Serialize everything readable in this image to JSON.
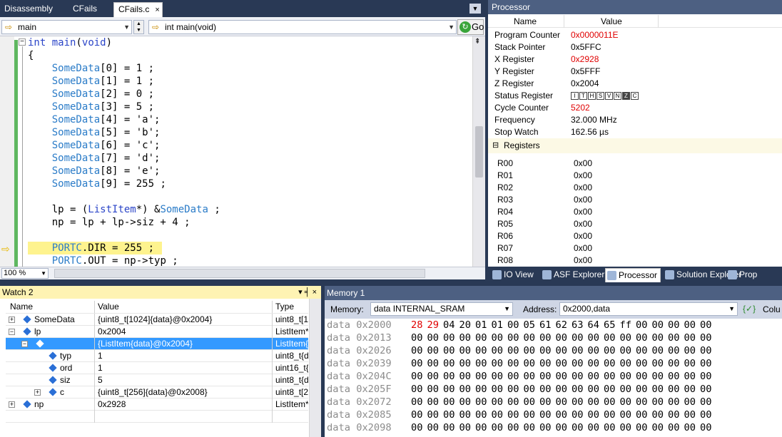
{
  "editor_tabs": [
    {
      "label": "Disassembly"
    },
    {
      "label": "CFails"
    },
    {
      "label": "CFails.c",
      "close": "×"
    }
  ],
  "navbar": {
    "scope": "main",
    "function": "int main(void)",
    "go_label": "Go"
  },
  "code_lines": [
    {
      "t": "int main(void)"
    },
    {
      "t": "{"
    },
    {
      "t": "    SomeData[0] = 1 ;"
    },
    {
      "t": "    SomeData[1] = 1 ;"
    },
    {
      "t": "    SomeData[2] = 0 ;"
    },
    {
      "t": "    SomeData[3] = 5 ;"
    },
    {
      "t": "    SomeData[4] = 'a';"
    },
    {
      "t": "    SomeData[5] = 'b';"
    },
    {
      "t": "    SomeData[6] = 'c';"
    },
    {
      "t": "    SomeData[7] = 'd';"
    },
    {
      "t": "    SomeData[8] = 'e';"
    },
    {
      "t": "    SomeData[9] = 255 ;"
    },
    {
      "t": ""
    },
    {
      "t": "    lp = (ListItem*) &SomeData ;"
    },
    {
      "t": "    np = lp + lp->siz + 4 ;"
    },
    {
      "t": ""
    },
    {
      "t": "    PORTC.DIR = 255 ;"
    },
    {
      "t": "    PORTC.OUT = np->typ ;"
    }
  ],
  "zoom": "100 %",
  "processor": {
    "title": "Processor",
    "col_name": "Name",
    "col_value": "Value",
    "rows": [
      {
        "name": "Program Counter",
        "value": "0x0000011E",
        "changed": true
      },
      {
        "name": "Stack Pointer",
        "value": "0x5FFC",
        "changed": false
      },
      {
        "name": "X Register",
        "value": "0x2928",
        "changed": true
      },
      {
        "name": "Y Register",
        "value": "0x5FFF",
        "changed": false
      },
      {
        "name": "Z Register",
        "value": "0x2004",
        "changed": false
      },
      {
        "name": "Status Register",
        "value": "",
        "changed": false
      },
      {
        "name": "Cycle Counter",
        "value": "5202",
        "changed": true
      },
      {
        "name": "Frequency",
        "value": "32.000 MHz",
        "changed": false
      },
      {
        "name": "Stop Watch",
        "value": "162.56 µs",
        "changed": false
      }
    ],
    "status_flags": [
      "I",
      "T",
      "H",
      "S",
      "V",
      "N",
      "Z",
      "C"
    ],
    "status_flags_set": [
      "Z"
    ],
    "registers_label": "Registers",
    "registers": [
      {
        "name": "R00",
        "value": "0x00"
      },
      {
        "name": "R01",
        "value": "0x00"
      },
      {
        "name": "R02",
        "value": "0x00"
      },
      {
        "name": "R03",
        "value": "0x00"
      },
      {
        "name": "R04",
        "value": "0x00"
      },
      {
        "name": "R05",
        "value": "0x00"
      },
      {
        "name": "R06",
        "value": "0x00"
      },
      {
        "name": "R07",
        "value": "0x00"
      },
      {
        "name": "R08",
        "value": "0x00"
      }
    ]
  },
  "tool_tabs": [
    {
      "label": "IO View"
    },
    {
      "label": "ASF Explorer"
    },
    {
      "label": "Processor"
    },
    {
      "label": "Solution Explorer"
    },
    {
      "label": "Prop"
    }
  ],
  "watch": {
    "title": "Watch 2",
    "controls": "▾ ╡ ×",
    "headers": [
      "Name",
      "Value",
      "Type"
    ],
    "rows": [
      {
        "name": "SomeData",
        "value": "{uint8_t[1024]{data}@0x2004}",
        "type": "uint8_t[1",
        "exp": "+"
      },
      {
        "name": "lp",
        "value": "0x2004",
        "type": "ListItem*",
        "exp": "−"
      },
      {
        "name": "",
        "value": "{ListItem{data}@0x2004}",
        "type": "ListItem{",
        "exp": "−"
      },
      {
        "name": "typ",
        "value": "1",
        "type": "uint8_t{d",
        "exp": ""
      },
      {
        "name": "ord",
        "value": "1",
        "type": "uint16_t{",
        "exp": ""
      },
      {
        "name": "siz",
        "value": "5",
        "type": "uint8_t{d",
        "exp": ""
      },
      {
        "name": "c",
        "value": "{uint8_t[256]{data}@0x2008}",
        "type": "uint8_t[2",
        "exp": "+"
      },
      {
        "name": "np",
        "value": "0x2928",
        "type": "ListItem*",
        "exp": "+"
      }
    ]
  },
  "memory": {
    "title": "Memory 1",
    "memory_label": "Memory:",
    "memory_value": "data INTERNAL_SRAM",
    "address_label": "Address:",
    "address_value": "0x2000,data",
    "columns_label": "Colu",
    "rows": [
      {
        "addr": "data 0x2000",
        "bytes": [
          "28",
          "29",
          "04",
          "20",
          "01",
          "01",
          "00",
          "05",
          "61",
          "62",
          "63",
          "64",
          "65",
          "ff",
          "00",
          "00",
          "00",
          "00",
          "00"
        ],
        "red": [
          0,
          1
        ]
      },
      {
        "addr": "data 0x2013",
        "bytes": [
          "00",
          "00",
          "00",
          "00",
          "00",
          "00",
          "00",
          "00",
          "00",
          "00",
          "00",
          "00",
          "00",
          "00",
          "00",
          "00",
          "00",
          "00",
          "00"
        ],
        "red": []
      },
      {
        "addr": "data 0x2026",
        "bytes": [
          "00",
          "00",
          "00",
          "00",
          "00",
          "00",
          "00",
          "00",
          "00",
          "00",
          "00",
          "00",
          "00",
          "00",
          "00",
          "00",
          "00",
          "00",
          "00"
        ],
        "red": []
      },
      {
        "addr": "data 0x2039",
        "bytes": [
          "00",
          "00",
          "00",
          "00",
          "00",
          "00",
          "00",
          "00",
          "00",
          "00",
          "00",
          "00",
          "00",
          "00",
          "00",
          "00",
          "00",
          "00",
          "00"
        ],
        "red": []
      },
      {
        "addr": "data 0x204C",
        "bytes": [
          "00",
          "00",
          "00",
          "00",
          "00",
          "00",
          "00",
          "00",
          "00",
          "00",
          "00",
          "00",
          "00",
          "00",
          "00",
          "00",
          "00",
          "00",
          "00"
        ],
        "red": []
      },
      {
        "addr": "data 0x205F",
        "bytes": [
          "00",
          "00",
          "00",
          "00",
          "00",
          "00",
          "00",
          "00",
          "00",
          "00",
          "00",
          "00",
          "00",
          "00",
          "00",
          "00",
          "00",
          "00",
          "00"
        ],
        "red": []
      },
      {
        "addr": "data 0x2072",
        "bytes": [
          "00",
          "00",
          "00",
          "00",
          "00",
          "00",
          "00",
          "00",
          "00",
          "00",
          "00",
          "00",
          "00",
          "00",
          "00",
          "00",
          "00",
          "00",
          "00"
        ],
        "red": []
      },
      {
        "addr": "data 0x2085",
        "bytes": [
          "00",
          "00",
          "00",
          "00",
          "00",
          "00",
          "00",
          "00",
          "00",
          "00",
          "00",
          "00",
          "00",
          "00",
          "00",
          "00",
          "00",
          "00",
          "00"
        ],
        "red": []
      },
      {
        "addr": "data 0x2098",
        "bytes": [
          "00",
          "00",
          "00",
          "00",
          "00",
          "00",
          "00",
          "00",
          "00",
          "00",
          "00",
          "00",
          "00",
          "00",
          "00",
          "00",
          "00",
          "00",
          "00"
        ],
        "red": []
      }
    ]
  },
  "colors": {
    "changed_value": "#e00000",
    "current_line": "#fef38e",
    "selection": "#3399ff",
    "window_frame": "#293955"
  }
}
